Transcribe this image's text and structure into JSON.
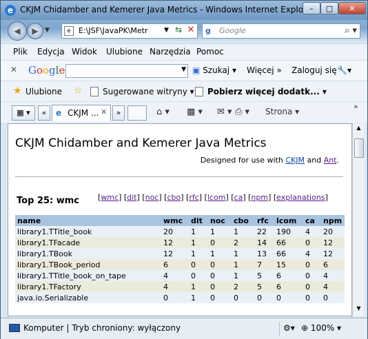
{
  "window": {
    "title": "CKJM Chidamber and Kemerer Java Metrics - Windows Internet Explorer",
    "min": "–",
    "max": "□",
    "close": "✕"
  },
  "nav": {
    "address": "E:\\JSF\\JavaPK\\Metr",
    "search_placeholder": "Google"
  },
  "menu": [
    "Plik",
    "Edycja",
    "Widok",
    "Ulubione",
    "Narzędzia",
    "Pomoc"
  ],
  "google_toolbar": {
    "logo": "Google",
    "search_button": "Szukaj",
    "more": "Więcej »",
    "login": "Zaloguj się"
  },
  "favorites": {
    "label": "Ulubione",
    "suggested": "Sugerowane witryny ▾",
    "addons": "Pobierz więcej dodatk... ▾"
  },
  "tabs": {
    "active_tab": "CKJM ...",
    "page_menu": "Strona ▾"
  },
  "page": {
    "title": "CKJM Chidamber and Kemerer Java Metrics",
    "designed_prefix": "Designed for use with",
    "ckjm": "CKJM",
    "and": "and",
    "ant": "Ant",
    "period": ".",
    "heading": "Top 25: wmc",
    "metric_links": [
      "wmc",
      "dit",
      "noc",
      "cbo",
      "rfc",
      "lcom",
      "ca",
      "npm",
      "explanations"
    ],
    "columns": [
      "name",
      "wmc",
      "dit",
      "noc",
      "cbo",
      "rfc",
      "lcom",
      "ca",
      "npm"
    ],
    "rows": [
      [
        "library1.TTitle_book",
        "20",
        "1",
        "1",
        "1",
        "22",
        "190",
        "4",
        "20"
      ],
      [
        "library1.TFacade",
        "12",
        "1",
        "0",
        "2",
        "14",
        "66",
        "0",
        "12"
      ],
      [
        "library1.TBook",
        "12",
        "1",
        "1",
        "1",
        "13",
        "66",
        "4",
        "12"
      ],
      [
        "library1.TBook_period",
        "6",
        "0",
        "0",
        "1",
        "7",
        "15",
        "0",
        "6"
      ],
      [
        "library1.TTitle_book_on_tape",
        "4",
        "0",
        "0",
        "1",
        "5",
        "6",
        "0",
        "4"
      ],
      [
        "library1.TFactory",
        "4",
        "1",
        "0",
        "2",
        "5",
        "6",
        "0",
        "4"
      ],
      [
        "java.io.Serializable",
        "0",
        "1",
        "0",
        "0",
        "0",
        "0",
        "0",
        "0"
      ]
    ]
  },
  "status": {
    "text": "Komputer | Tryb chroniony: wyłączony",
    "zoom": "100%"
  }
}
